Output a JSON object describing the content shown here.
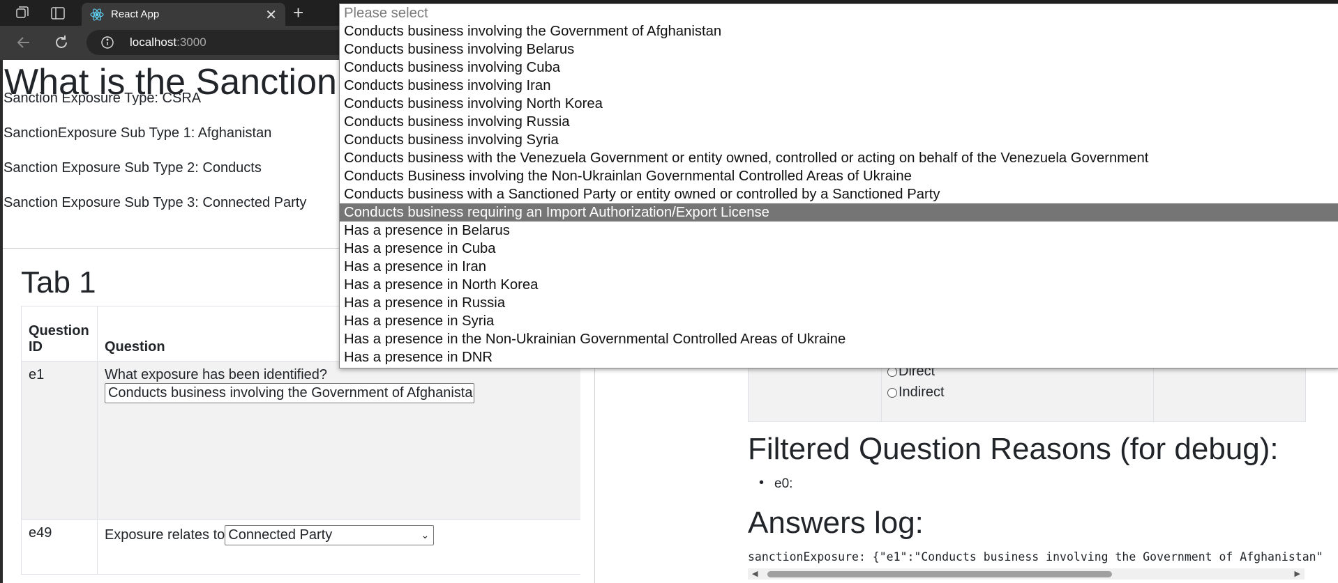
{
  "browser": {
    "tab_title": "React App",
    "close_glyph": "✕",
    "new_tab_glyph": "+",
    "url_host": "localhost",
    "url_port": ":3000"
  },
  "page": {
    "title": "What is the Sanction",
    "info_lines": [
      "Sanction Exposure Type: CSRA",
      "SanctionExposure Sub Type 1: Afghanistan",
      "Sanction Exposure Sub Type 2: Conducts",
      "Sanction Exposure Sub Type 3: Connected Party"
    ],
    "tab_heading": "Tab 1",
    "table": {
      "headers": [
        "Question ID",
        "Question"
      ],
      "rows": [
        {
          "id": "e1",
          "question": "What exposure has been identified?",
          "select_value": "Conducts business involving the Government of Afghanistan"
        },
        {
          "id": "e49",
          "question": "Exposure relates to",
          "select_value": "Connected Party"
        }
      ]
    },
    "right": {
      "radio_options": [
        "Direct",
        "Indirect"
      ],
      "debug_heading": "Filtered Question Reasons (for debug):",
      "debug_items": [
        "e0:"
      ],
      "log_heading": "Answers log:",
      "log_line": "sanctionExposure: {\"e1\":\"Conducts business involving the Government of Afghanistan\""
    }
  },
  "dropdown": {
    "selected_index": 11,
    "options": [
      "Please select",
      "Conducts business involving the Government of Afghanistan",
      "Conducts business involving Belarus",
      "Conducts business involving Cuba",
      "Conducts business involving Iran",
      "Conducts business involving North Korea",
      "Conducts business involving Russia",
      "Conducts business involving Syria",
      "Conducts business with the Venezuela Government or entity owned, controlled or acting on behalf of the Venezuela Government",
      "Conducts Business involving the Non-Ukrainlan Governmental Controlled Areas of Ukraine",
      "Conducts business with a Sanctioned Party or entity owned or controlled by a Sanctioned Party",
      "Conducts business requiring an Import Authorization/Export License",
      "Has a presence in Belarus",
      "Has a presence in Cuba",
      "Has a presence in Iran",
      "Has a presence in North Korea",
      "Has a presence in Russia",
      "Has a presence in Syria",
      "Has a presence in the Non-Ukrainian Governmental Controlled Areas of Ukraine",
      "Has a presence in DNR"
    ]
  }
}
